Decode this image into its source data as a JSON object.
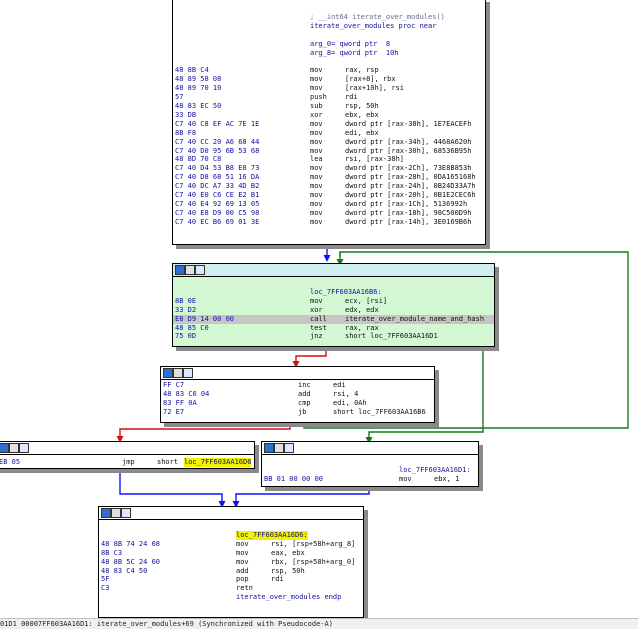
{
  "colors": {
    "edge_true": "#1a7a1a",
    "edge_false": "#d01010",
    "edge_uncond": "#1010ff",
    "node_hilite": "#d4f7d4",
    "label_highlight": "#f3f300"
  },
  "icons": [
    "graph-color-icon",
    "edit-icon",
    "group-icon"
  ],
  "nodes": [
    {
      "id": "n1",
      "lines": [
        {
          "b": "",
          "m": "; __int64 iterate_over_modules()",
          "o": "",
          "comment": true
        },
        {
          "b": "",
          "m": "iterate_over_modules proc near",
          "o": ""
        },
        {
          "b": "",
          "m": "",
          "o": ""
        },
        {
          "b": "",
          "m": "arg_0= qword ptr  8",
          "o": ""
        },
        {
          "b": "",
          "m": "arg_8= qword ptr  10h",
          "o": ""
        },
        {
          "b": "",
          "m": "",
          "o": ""
        },
        {
          "b": "48 8B C4",
          "m": "mov",
          "o": "rax, rsp"
        },
        {
          "b": "48 89 58 08",
          "m": "mov",
          "o": "[rax+8], rbx"
        },
        {
          "b": "48 89 70 10",
          "m": "mov",
          "o": "[rax+10h], rsi"
        },
        {
          "b": "57",
          "m": "push",
          "o": "rdi"
        },
        {
          "b": "48 83 EC 50",
          "m": "sub",
          "o": "rsp, 50h"
        },
        {
          "b": "33 DB",
          "m": "xor",
          "o": "ebx, ebx"
        },
        {
          "b": "C7 40 C8 EF AC 7E 1E",
          "m": "mov",
          "o": "dword ptr [rax-38h], 1E7EACEFh"
        },
        {
          "b": "8B F8",
          "m": "mov",
          "o": "edi, ebx"
        },
        {
          "b": "C7 40 CC 20 A6 68 44",
          "m": "mov",
          "o": "dword ptr [rax-34h], 4468A620h"
        },
        {
          "b": "C7 40 D0 95 6B 53 68",
          "m": "mov",
          "o": "dword ptr [rax-30h], 68536B95h"
        },
        {
          "b": "48 8D 70 C8",
          "m": "lea",
          "o": "rsi, [rax-38h]"
        },
        {
          "b": "C7 40 D4 53 B8 E8 73",
          "m": "mov",
          "o": "dword ptr [rax-2Ch], 73E8B853h"
        },
        {
          "b": "C7 40 D8 68 51 16 DA",
          "m": "mov",
          "o": "dword ptr [rax-28h], 0DA165168h"
        },
        {
          "b": "C7 40 DC A7 33 4D B2",
          "m": "mov",
          "o": "dword ptr [rax-24h], 0B24D33A7h"
        },
        {
          "b": "C7 40 E0 C6 CE E2 B1",
          "m": "mov",
          "o": "dword ptr [rax-20h], 0B1E2CEC6h"
        },
        {
          "b": "C7 40 E4 92 69 13 05",
          "m": "mov",
          "o": "dword ptr [rax-1Ch], 5136992h"
        },
        {
          "b": "C7 40 E8 D9 00 C5 98",
          "m": "mov",
          "o": "dword ptr [rax-18h], 98C500D9h"
        },
        {
          "b": "C7 40 EC B6 69 01 3E",
          "m": "mov",
          "o": "dword ptr [rax-14h], 3E0169B6h"
        }
      ]
    },
    {
      "id": "n2",
      "lines": [
        {
          "b": "",
          "m": "",
          "o": ""
        },
        {
          "b": "",
          "m": "loc_7FF603AA16B6:",
          "o": ""
        },
        {
          "b": "8B 0E",
          "m": "mov",
          "o": "ecx, [rsi]"
        },
        {
          "b": "33 D2",
          "m": "xor",
          "o": "edx, edx"
        },
        {
          "b": "E8 D9 14 00 00",
          "m": "call",
          "o": "iterate_over_module_name_and_hash",
          "hl": true
        },
        {
          "b": "48 85 C0",
          "m": "test",
          "o": "rax, rax"
        },
        {
          "b": "75 0D",
          "m": "jnz",
          "o": "short loc_7FF603AA16D1"
        }
      ]
    },
    {
      "id": "n3",
      "lines": [
        {
          "b": "FF C7",
          "m": "inc",
          "o": "edi"
        },
        {
          "b": "48 83 C6 04",
          "m": "add",
          "o": "rsi, 4"
        },
        {
          "b": "83 FF 0A",
          "m": "cmp",
          "o": "edi, 0Ah"
        },
        {
          "b": "72 E7",
          "m": "jb",
          "o": "short loc_7FF603AA16B6"
        }
      ]
    },
    {
      "id": "n4",
      "lines": [
        {
          "b": "EB 05",
          "m": "jmp",
          "o": "short ",
          "ohl": "loc_7FF603AA16D6"
        }
      ]
    },
    {
      "id": "n5",
      "lines": [
        {
          "b": "",
          "m": "",
          "o": ""
        },
        {
          "b": "",
          "m": "loc_7FF603AA16D1:",
          "o": ""
        },
        {
          "b": "BB 01 00 00 00",
          "m": "mov",
          "o": "ebx, 1"
        }
      ]
    },
    {
      "id": "n6",
      "lines": [
        {
          "b": "",
          "m": "",
          "o": ""
        },
        {
          "b": "",
          "m": "",
          "mhl": "loc_7FF603AA16D6:",
          "o": ""
        },
        {
          "b": "48 8B 74 24 68",
          "m": "mov",
          "o": "rsi, [rsp+58h+arg_8]"
        },
        {
          "b": "8B C3",
          "m": "mov",
          "o": "eax, ebx"
        },
        {
          "b": "48 8B 5C 24 60",
          "m": "mov",
          "o": "rbx, [rsp+58h+arg_0]"
        },
        {
          "b": "48 83 C4 50",
          "m": "add",
          "o": "rsp, 50h"
        },
        {
          "b": "5F",
          "m": "pop",
          "o": "rdi"
        },
        {
          "b": "C3",
          "m": "retn",
          "o": ""
        },
        {
          "b": "",
          "m": "iterate_over_modules endp",
          "o": ""
        }
      ]
    }
  ],
  "status_text": "01D1 00007FF603AA16D1: iterate_over_modules+69 (Synchronized with Pseudocode-A)"
}
